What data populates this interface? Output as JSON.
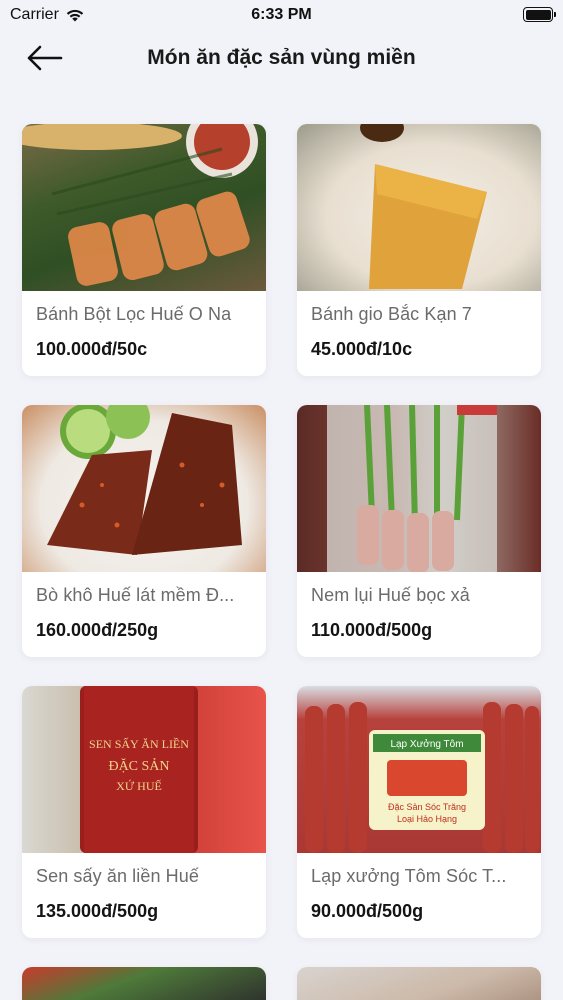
{
  "status_bar": {
    "carrier": "Carrier",
    "time": "6:33 PM"
  },
  "header": {
    "title": "Món ăn đặc sản vùng miền"
  },
  "products": [
    {
      "name": "Bánh Bột Lọc Huế O Na",
      "price": "100.000đ/50c",
      "image": "img-1"
    },
    {
      "name": "Bánh gio Bắc Kạn 7",
      "price": "45.000đ/10c",
      "image": "img-2"
    },
    {
      "name": "Bò khô Huế lát mềm Đ...",
      "price": "160.000đ/250g",
      "image": "img-3"
    },
    {
      "name": "Nem lụi Huế bọc xả",
      "price": "110.000đ/500g",
      "image": "img-4"
    },
    {
      "name": "Sen sấy ăn liền Huế",
      "price": "135.000đ/500g",
      "image": "img-5"
    },
    {
      "name": "Lạp xưởng Tôm Sóc T...",
      "price": "90.000đ/500g",
      "image": "img-6"
    }
  ],
  "image_text": {
    "sen_jar_line1": "SEN SẤY ĂN LIỀN",
    "sen_jar_line2": "ĐẶC SẢN",
    "sen_jar_line3": "XỨ HUẾ",
    "lap_xuong_label": "Lạp Xưởng Tôm",
    "lap_xuong_sub1": "Đặc Sản Sóc Trăng",
    "lap_xuong_sub2": "Loại Hảo Hạng"
  },
  "colors": {
    "background": "#f2f3f8",
    "card": "#ffffff",
    "name_text": "#6b6b6b",
    "price_text": "#141414"
  }
}
